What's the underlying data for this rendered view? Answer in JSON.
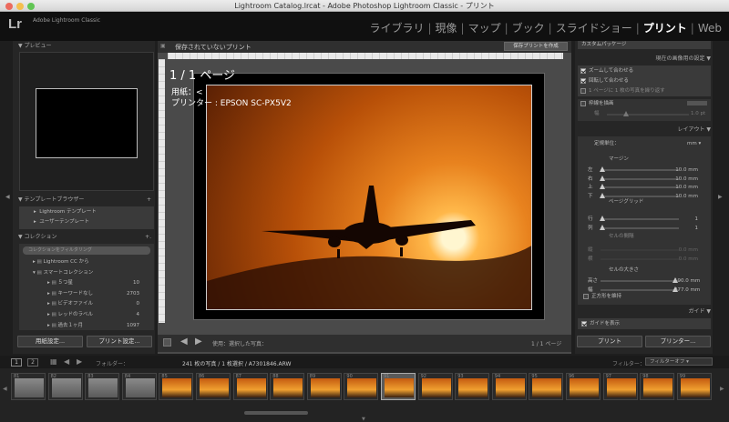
{
  "window": {
    "title": "Lightroom Catalog.lrcat - Adobe Photoshop Lightroom Classic - プリント"
  },
  "app": {
    "logo": "Lr",
    "name": "Adobe Lightroom Classic"
  },
  "modules": [
    {
      "label": "ライブラリ",
      "active": false
    },
    {
      "label": "現像",
      "active": false
    },
    {
      "label": "マップ",
      "active": false
    },
    {
      "label": "ブック",
      "active": false
    },
    {
      "label": "スライドショー",
      "active": false
    },
    {
      "label": "プリント",
      "active": true
    },
    {
      "label": "Web",
      "active": false
    }
  ],
  "left": {
    "preview_header": "プレビュー",
    "templates_header": "テンプレートブラウザー",
    "templates": [
      "Lightroom テンプレート",
      "ユーザーテンプレート"
    ],
    "collections_header": "コレクション",
    "filter_placeholder": "コレクションをフィルタリング",
    "collections": [
      {
        "label": "Lightroom CC から",
        "count": ""
      },
      {
        "label": "スマートコレクション",
        "count": ""
      },
      {
        "label": "５つ星",
        "count": "10"
      },
      {
        "label": "キーワードなし",
        "count": "2703"
      },
      {
        "label": "ビデオファイル",
        "count": "0"
      },
      {
        "label": "レッドのラベル",
        "count": "4"
      },
      {
        "label": "過去１ヶ月",
        "count": "1097"
      }
    ],
    "page_setup_button": "用紙設定...",
    "print_settings_button": "プリント設定..."
  },
  "center": {
    "doc_title": "保存されていないプリント",
    "save_print_button": "保存プリントを作成",
    "page_label": "1 / 1 ページ",
    "paper_label": "用紙：<",
    "printer_label": "プリンター : EPSON SC-PX5V2",
    "use_label": "使用：選択した写真：",
    "page_count": "1 / 1 ページ"
  },
  "right": {
    "custom_package": "カスタムパッケージ",
    "image_settings_header": "現在の画像用の設定",
    "image_settings": [
      {
        "label": "ズームして合わせる",
        "on": true
      },
      {
        "label": "回転して合わせる",
        "on": true
      },
      {
        "label": "1 ページに 1 枚の写真を繰り返す",
        "on": false
      }
    ],
    "stroke_label": "枠線を描画",
    "stroke_width_label": "幅",
    "stroke_value": "1.0 pt",
    "layout_header": "レイアウト",
    "ruler_units_label": "定規単位：",
    "ruler_units_value": "mm",
    "margins_label": "マージン",
    "margins": [
      {
        "label": "左",
        "value": "10.0 mm",
        "pos": 0.02
      },
      {
        "label": "右",
        "value": "10.0 mm",
        "pos": 0.02
      },
      {
        "label": "上",
        "value": "10.0 mm",
        "pos": 0.02
      },
      {
        "label": "下",
        "value": "10.0 mm",
        "pos": 0.02
      }
    ],
    "page_grid_label": "ページグリッド",
    "grid": [
      {
        "label": "行",
        "value": "1",
        "pos": 0.02
      },
      {
        "label": "列",
        "value": "1",
        "pos": 0.02
      }
    ],
    "cell_spacing_label": "セルの間隔",
    "spacing": [
      {
        "label": "縦",
        "value": "0.0 mm"
      },
      {
        "label": "横",
        "value": "0.0 mm"
      }
    ],
    "cell_size_label": "セルの大きさ",
    "cell_size": [
      {
        "label": "高さ",
        "value": "190.0 mm",
        "pos": 0.95
      },
      {
        "label": "幅",
        "value": "277.0 mm",
        "pos": 0.95
      }
    ],
    "square_label": "正方形を維持",
    "guides_header": "ガイド",
    "show_guides_label": "ガイドを表示",
    "print_button": "プリント",
    "printer_button": "プリンター..."
  },
  "filmstrip": {
    "folder_label": "フォルダー：",
    "count_text": "241 枚の写真 / 1 枚選択 / A7301846.ARW",
    "filter_label": "フィルター：",
    "filter_value": "フィルターオフ",
    "page1": "1",
    "page2": "2",
    "thumb_numbers": [
      "81",
      "82",
      "83",
      "84",
      "85",
      "86",
      "87",
      "88",
      "89",
      "90",
      "91",
      "92",
      "93",
      "94",
      "95",
      "96",
      "97",
      "98",
      "99"
    ]
  }
}
